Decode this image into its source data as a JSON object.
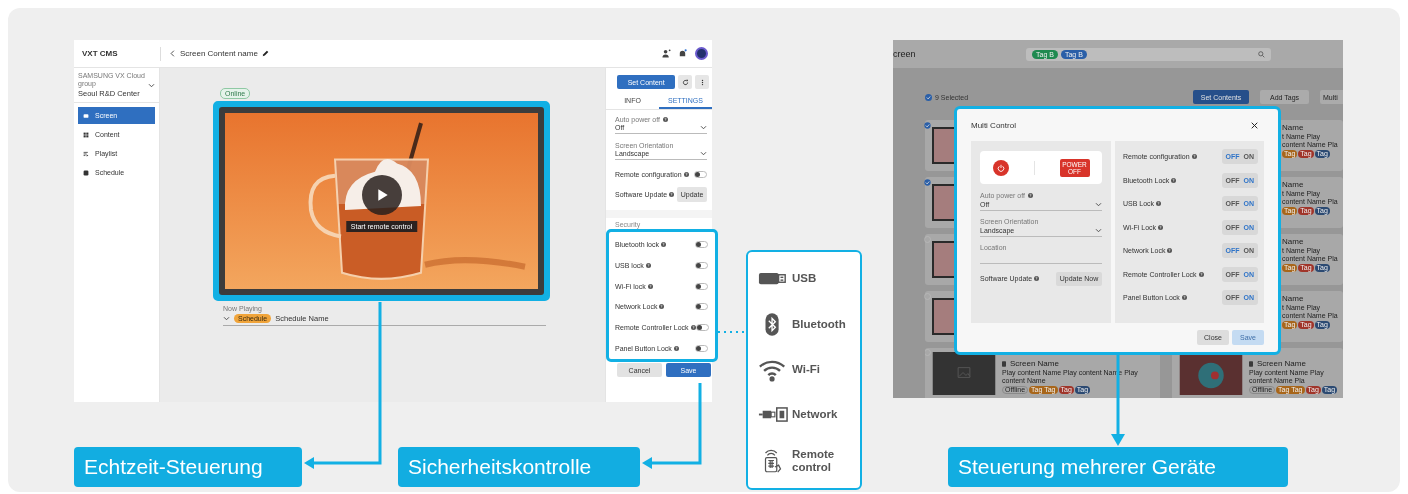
{
  "callouts": [
    {
      "text": "Echtzeit-Steuerung"
    },
    {
      "text": "Sicherheitskontrolle"
    },
    {
      "text": "Steuerung mehrerer Geräte"
    }
  ],
  "single_screen": {
    "app_title": "VXT CMS",
    "page_title": "Screen Content name",
    "group_caption": "SAMSUNG VX Cloud group",
    "group_name": "Seoul R&D Center",
    "nav": [
      {
        "label": "Screen",
        "kind": "screen",
        "selected": true
      },
      {
        "label": "Content",
        "kind": "content",
        "selected": false
      },
      {
        "label": "Playlist",
        "kind": "playlist",
        "selected": false
      },
      {
        "label": "Schedule",
        "kind": "schedule",
        "selected": false
      }
    ],
    "status_badge": "Online",
    "video_caption": "Start remote control",
    "now_playing_label": "Now Playing",
    "schedule_badge": "Schedule",
    "schedule_name": "Schedule Name",
    "set_content_button": "Set Content",
    "tabs": [
      {
        "label": "INFO",
        "selected": false
      },
      {
        "label": "SETTINGS",
        "selected": true
      }
    ],
    "fields": [
      {
        "label": "Auto power off",
        "value": "Off",
        "help": true
      },
      {
        "label": "Screen Orientation",
        "value": "Landscape",
        "help": false
      }
    ],
    "remote_configuration": {
      "label": "Remote configuration",
      "on": false
    },
    "software_update": {
      "label": "Software Update",
      "button": "Update"
    },
    "security_heading": "Security",
    "locks": [
      {
        "label": "Bluetooth lock",
        "on": false
      },
      {
        "label": "USB lock",
        "on": false
      },
      {
        "label": "Wi-Fi lock",
        "on": false
      },
      {
        "label": "Network Lock",
        "on": false
      },
      {
        "label": "Remote Controller Lock",
        "on": false
      },
      {
        "label": "Panel Button Lock",
        "on": false
      }
    ],
    "buttons": [
      {
        "label": "Cancel",
        "kind": "secondary"
      },
      {
        "label": "Save",
        "kind": "primary"
      }
    ]
  },
  "security_features": [
    {
      "kind": "usb",
      "label": "USB"
    },
    {
      "kind": "bluetooth",
      "label": "Bluetooth"
    },
    {
      "kind": "wifi",
      "label": "Wi-Fi"
    },
    {
      "kind": "network",
      "label": "Network"
    },
    {
      "kind": "remote",
      "label": "Remote control"
    }
  ],
  "multi_screen": {
    "page_title": "creen",
    "search_tags": [
      {
        "label": "Tag B",
        "color": "#1f8a50"
      },
      {
        "label": "Tag B",
        "color": "#2a5fa8"
      }
    ],
    "selection_count": "9 Selected",
    "toolbar_buttons": [
      {
        "label": "Set Contents",
        "kind": "primary"
      },
      {
        "label": "Add Tags",
        "kind": "secondary"
      },
      {
        "label": "Multi",
        "kind": "secondary"
      }
    ],
    "card_rows": [
      {
        "checked": true,
        "name": "Name",
        "description": "t Name Play content Name Pla",
        "tags": [
          {
            "label": "Tag",
            "color": "#a8661a"
          },
          {
            "label": "Tag",
            "color": "#a0352a"
          },
          {
            "label": "Tag",
            "color": "#2c4a72"
          }
        ]
      },
      {
        "checked": true,
        "name": "Name",
        "description": "t Name Play content Name Pla",
        "tags": [
          {
            "label": "Tag",
            "color": "#a8661a"
          },
          {
            "label": "Tag",
            "color": "#a0352a"
          },
          {
            "label": "Tag",
            "color": "#2c4a72"
          }
        ]
      },
      {
        "checked": false,
        "name": "Name",
        "description": "t Name Play content Name Pla",
        "tags": [
          {
            "label": "Tag",
            "color": "#a8661a"
          },
          {
            "label": "Tag",
            "color": "#a0352a"
          },
          {
            "label": "Tag",
            "color": "#2c4a72"
          }
        ]
      },
      {
        "checked": false,
        "name": "Name",
        "description": "t Name Play content Name Pla",
        "tags": [
          {
            "label": "Tag",
            "color": "#a8661a"
          },
          {
            "label": "Tag",
            "color": "#a0352a"
          },
          {
            "label": "Tag",
            "color": "#2c4a72"
          }
        ]
      }
    ],
    "bottom_cards": [
      {
        "kind": "blank",
        "checked": false,
        "name": "Screen Name",
        "description": "Play content Name Play content Name Play content Name",
        "tags": [
          {
            "label": "Offline",
            "color": "#8a8a8a"
          },
          {
            "label": "Tag Tag",
            "color": "#a8661a"
          },
          {
            "label": "Tag",
            "color": "#a0352a"
          },
          {
            "label": "Tag",
            "color": "#2c4a72"
          }
        ]
      },
      {
        "kind": "image",
        "name": "Screen Name",
        "description": "Play content Name Play content Name Pla",
        "tags": [
          {
            "label": "Offline",
            "color": "#8a8a8a"
          },
          {
            "label": "Tag Tag",
            "color": "#a8661a"
          },
          {
            "label": "Tag",
            "color": "#a0352a"
          },
          {
            "label": "Tag",
            "color": "#2c4a72"
          }
        ]
      }
    ],
    "modal": {
      "title": "Multi Control",
      "power_off_label": "POWER OFF",
      "fields": [
        {
          "label": "Auto power off",
          "value": "Off",
          "help": true
        },
        {
          "label": "Screen Orientation",
          "value": "Landscape",
          "help": false
        },
        {
          "label": "Location",
          "help": false
        }
      ],
      "software_update": {
        "label": "Software Update",
        "button": "Update Now"
      },
      "switches": [
        {
          "label": "Remote configuration",
          "off_text": "OFF",
          "on_text": "ON",
          "on": false
        },
        {
          "label": "Bluetooth Lock",
          "off_text": "OFF",
          "on_text": "ON",
          "on": true
        },
        {
          "label": "USB Lock",
          "off_text": "OFF",
          "on_text": "ON",
          "on": true
        },
        {
          "label": "Wi-Fi Lock",
          "off_text": "OFF",
          "on_text": "ON",
          "on": true
        },
        {
          "label": "Network Lock",
          "off_text": "OFF",
          "on_text": "ON",
          "on": false
        },
        {
          "label": "Remote Controller Lock",
          "off_text": "OFF",
          "on_text": "ON",
          "on": true
        },
        {
          "label": "Panel Button Lock",
          "off_text": "OFF",
          "on_text": "ON",
          "on": true
        }
      ],
      "buttons": [
        {
          "label": "Close",
          "kind": "secondary",
          "disabled": false
        },
        {
          "label": "Save",
          "kind": "primary",
          "disabled": true
        }
      ]
    }
  }
}
